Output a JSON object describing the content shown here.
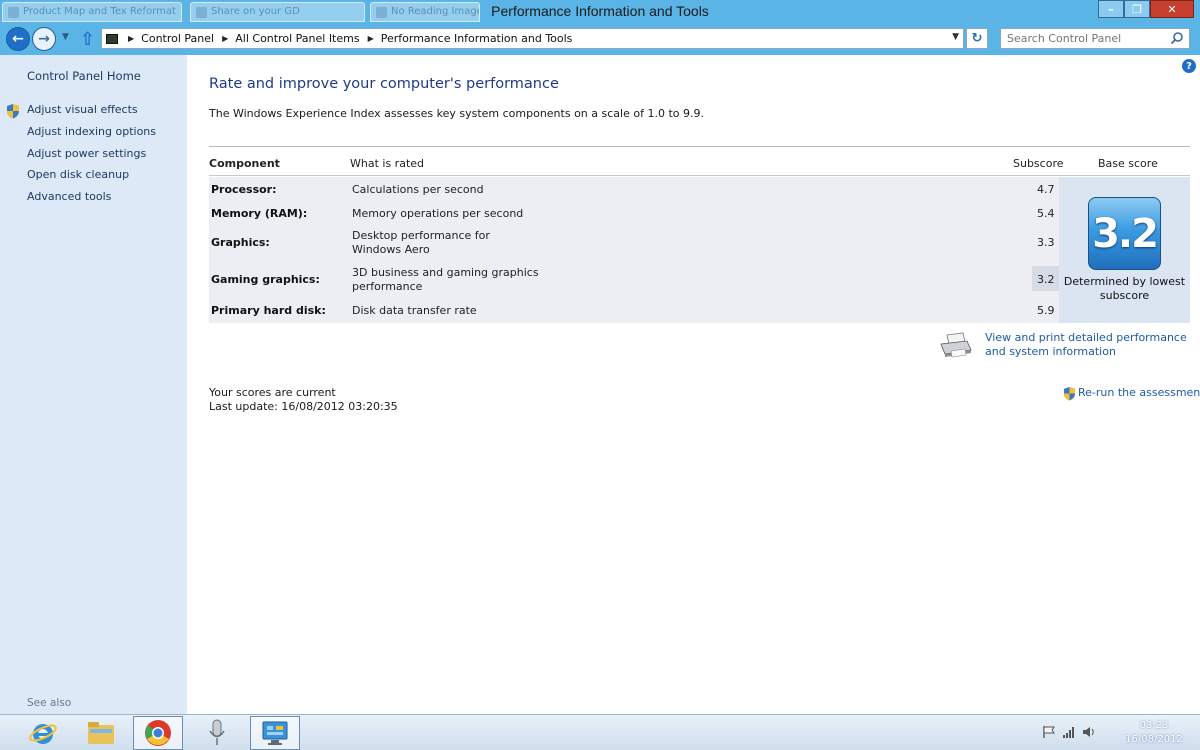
{
  "window": {
    "title": "Performance Information and Tools",
    "ghost_tabs": [
      "Product Map and Tex Reformat",
      "Share on your GD",
      "No Reading Image"
    ]
  },
  "nav": {
    "breadcrumbs": [
      "Control Panel",
      "All Control Panel Items",
      "Performance Information and Tools"
    ],
    "search_placeholder": "Search Control Panel"
  },
  "sidebar": {
    "home": "Control Panel Home",
    "links": [
      "Adjust visual effects",
      "Adjust indexing options",
      "Adjust power settings",
      "Open disk cleanup",
      "Advanced tools"
    ],
    "see_also": "See also"
  },
  "main": {
    "heading": "Rate and improve your computer's performance",
    "intro": "The Windows Experience Index assesses key system components on a scale of 1.0 to 9.9.",
    "columns": {
      "component": "Component",
      "what": "What is rated",
      "subscore": "Subscore",
      "base": "Base score"
    },
    "rows": [
      {
        "component": "Processor:",
        "what": "Calculations per second",
        "subscore": "4.7"
      },
      {
        "component": "Memory (RAM):",
        "what": "Memory operations per second",
        "subscore": "5.4"
      },
      {
        "component": "Graphics:",
        "what": "Desktop performance for Windows Aero",
        "subscore": "3.3"
      },
      {
        "component": "Gaming graphics:",
        "what": "3D business and gaming graphics performance",
        "subscore": "3.2"
      },
      {
        "component": "Primary hard disk:",
        "what": "Disk data transfer rate",
        "subscore": "5.9"
      }
    ],
    "base_score": "3.2",
    "base_caption": "Determined by lowest subscore",
    "print_link": "View and print detailed performance and system information",
    "status_current": "Your scores are current",
    "status_update": "Last update: 16/08/2012 03:20:35",
    "rerun": "Re-run the assessment"
  },
  "taskbar": {
    "apps": [
      "internet-explorer-icon",
      "file-explorer-icon",
      "chrome-icon",
      "microphone-icon",
      "control-panel-icon"
    ],
    "time": "03:23",
    "date": "16/08/2012"
  },
  "colors": {
    "titlebar": "#5bb4e6",
    "sidebar": "#dde9f6",
    "link": "#1e5aa8",
    "heading": "#1e3a8a",
    "badge": "#3a9be0"
  }
}
